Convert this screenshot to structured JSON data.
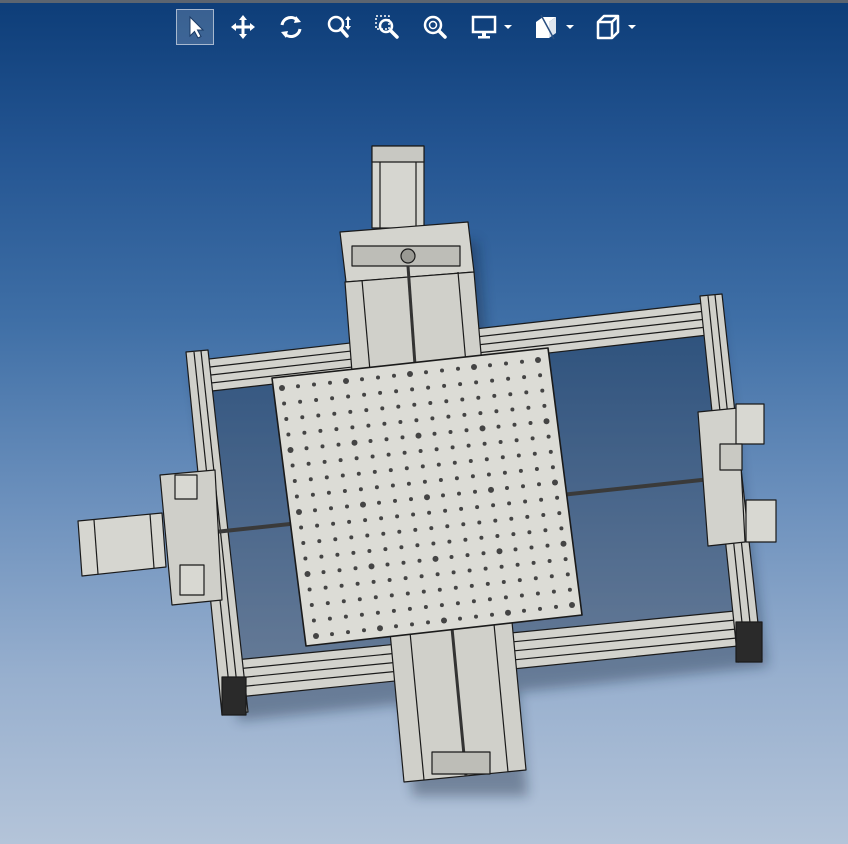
{
  "toolbar": {
    "tools": [
      {
        "icon": "select-arrow-icon",
        "active": true
      },
      {
        "icon": "pan-icon"
      },
      {
        "icon": "rotate-icon"
      },
      {
        "icon": "zoom-in-out-icon"
      },
      {
        "icon": "zoom-window-icon"
      },
      {
        "icon": "zoom-fit-icon"
      },
      {
        "icon": "display-style-icon",
        "dropdown": true
      },
      {
        "icon": "section-view-icon",
        "dropdown": true
      },
      {
        "icon": "view-orientation-icon",
        "dropdown": true
      }
    ]
  },
  "colors": {
    "background_top": "#0d3d78",
    "background_bottom": "#b4c4d9",
    "part_fill": "#d9d9d3",
    "part_edge": "#1a1a1a"
  },
  "viewport": {
    "model": "xy-gantry-table-assembly"
  }
}
